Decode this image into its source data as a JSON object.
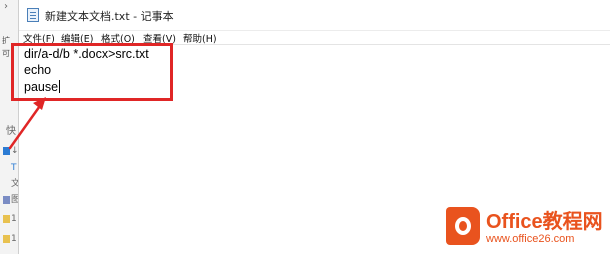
{
  "window": {
    "title": "新建文本文档.txt - 记事本"
  },
  "menu": {
    "items": [
      {
        "label": "文件(F)"
      },
      {
        "label": "编辑(E)"
      },
      {
        "label": "格式(O)"
      },
      {
        "label": "查看(V)"
      },
      {
        "label": "帮助(H)"
      }
    ]
  },
  "editor": {
    "lines": [
      "dir/a-d/b *.docx>src.txt",
      "echo",
      "pause"
    ]
  },
  "background": {
    "glyphs": [
      "扩",
      "可",
      "快",
      "T",
      "文",
      "图",
      "1",
      "1"
    ]
  },
  "watermark": {
    "name": "Office教程网",
    "url": "www.office26.com"
  },
  "colors": {
    "annotation": "#e02626",
    "brand": "#e9531e"
  },
  "icons": {
    "app": "notepad-icon",
    "arrow": "arrow-annotation"
  }
}
